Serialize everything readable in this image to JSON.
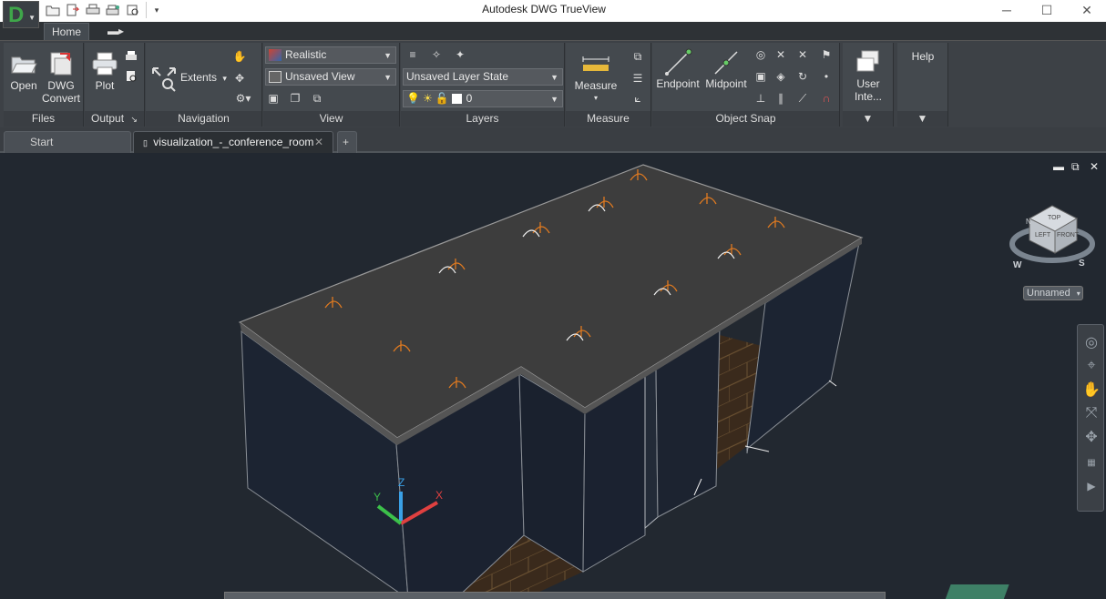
{
  "window": {
    "title": "Autodesk DWG TrueView"
  },
  "app_button": {
    "letter": "D"
  },
  "ribbon_tabs": [
    {
      "label": "Home",
      "active": true
    },
    {
      "label": "",
      "icon": "video-camera-icon"
    }
  ],
  "ribbon": {
    "files": {
      "title": "Files",
      "open_label": "Open",
      "dwg_label_1": "DWG",
      "dwg_label_2": "Convert"
    },
    "output": {
      "title": "Output",
      "plot_label": "Plot"
    },
    "navigation": {
      "title": "Navigation",
      "extents_label": "Extents"
    },
    "view": {
      "title": "View",
      "visual_style": "Realistic",
      "named_view": "Unsaved View"
    },
    "layers": {
      "title": "Layers",
      "layer_state": "Unsaved Layer State",
      "current_layer": "0"
    },
    "measure": {
      "title": "Measure",
      "measure_label": "Measure"
    },
    "object_snap": {
      "title": "Object Snap",
      "endpoint_label": "Endpoint",
      "midpoint_label": "Midpoint"
    },
    "user_interface": {
      "label": "User Inte..."
    },
    "help": {
      "label": "Help"
    }
  },
  "doc_tabs": [
    {
      "label": "Start",
      "active": false
    },
    {
      "label": "visualization_-_conference_room",
      "active": true
    }
  ],
  "viewcube": {
    "top": "TOP",
    "left": "LEFT",
    "front": "FRONT",
    "compass": [
      "N",
      "W",
      "S"
    ],
    "ucs_label": "Unnamed"
  },
  "ucs_axes": {
    "x": "X",
    "y": "Y",
    "z": "Z"
  },
  "colors": {
    "accent_green": "#3fa64a",
    "ribbon_bg": "#3d4146",
    "viewport_bg": "#222830",
    "light_orange": "#e07a20"
  }
}
